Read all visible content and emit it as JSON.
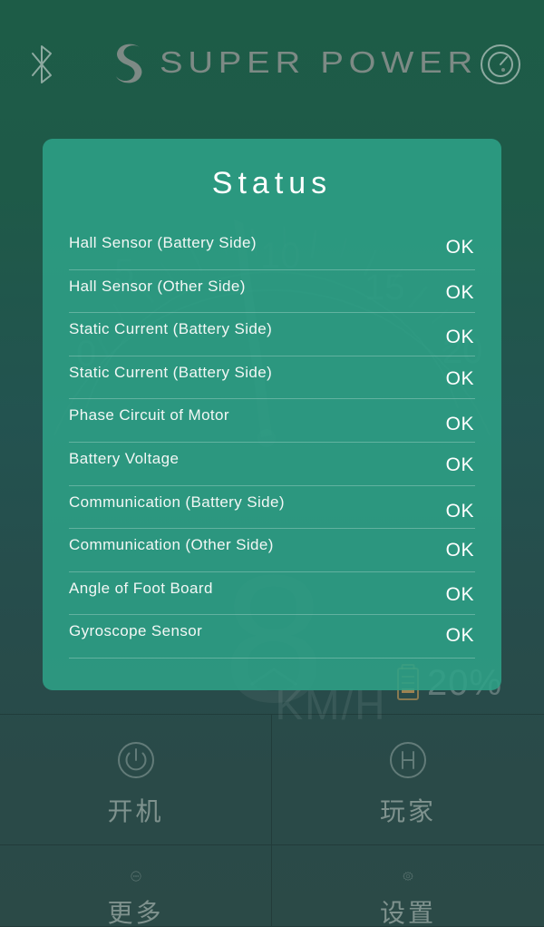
{
  "top_bar": {
    "bluetooth_icon": "bluetooth-icon",
    "brand_mark": "super-power-s-logo",
    "brand_text": "SUPER POWER",
    "gauge_icon": "speedometer-icon"
  },
  "watermark": {
    "speed_value": "8",
    "speed_unit": "KM/H",
    "ticks": [
      "0",
      "5",
      "10",
      "15",
      "20"
    ],
    "battery_percent": "20%",
    "battery_icon": "battery-icon"
  },
  "status_panel": {
    "title": "Status",
    "rows": [
      {
        "label": "Hall Sensor (Battery Side)",
        "value": "OK"
      },
      {
        "label": "Hall Sensor (Other Side)",
        "value": "OK"
      },
      {
        "label": "Static Current (Battery Side)",
        "value": "OK"
      },
      {
        "label": "Static Current (Battery Side)",
        "value": "OK"
      },
      {
        "label": "Phase Circuit of Motor",
        "value": "OK"
      },
      {
        "label": "Battery Voltage",
        "value": "OK"
      },
      {
        "label": "Communication (Battery Side)",
        "value": "OK"
      },
      {
        "label": "Communication (Other Side)",
        "value": "OK"
      },
      {
        "label": "Angle of Foot Board",
        "value": "OK"
      },
      {
        "label": "Gyroscope Sensor",
        "value": "OK"
      }
    ]
  },
  "bottom_grid": {
    "tiles": [
      {
        "label": "开机",
        "icon": "power-icon"
      },
      {
        "label": "玩家",
        "icon": "helmet-h-icon"
      },
      {
        "label": "更多",
        "icon": "more-dots-icon"
      },
      {
        "label": "设置",
        "icon": "gear-icon"
      }
    ]
  },
  "colors": {
    "background_top": "#1d5c47",
    "background_bottom": "#2a4a48",
    "panel": "#2ea086",
    "accent_text": "#ffffff",
    "battery_amber": "#c49656"
  }
}
